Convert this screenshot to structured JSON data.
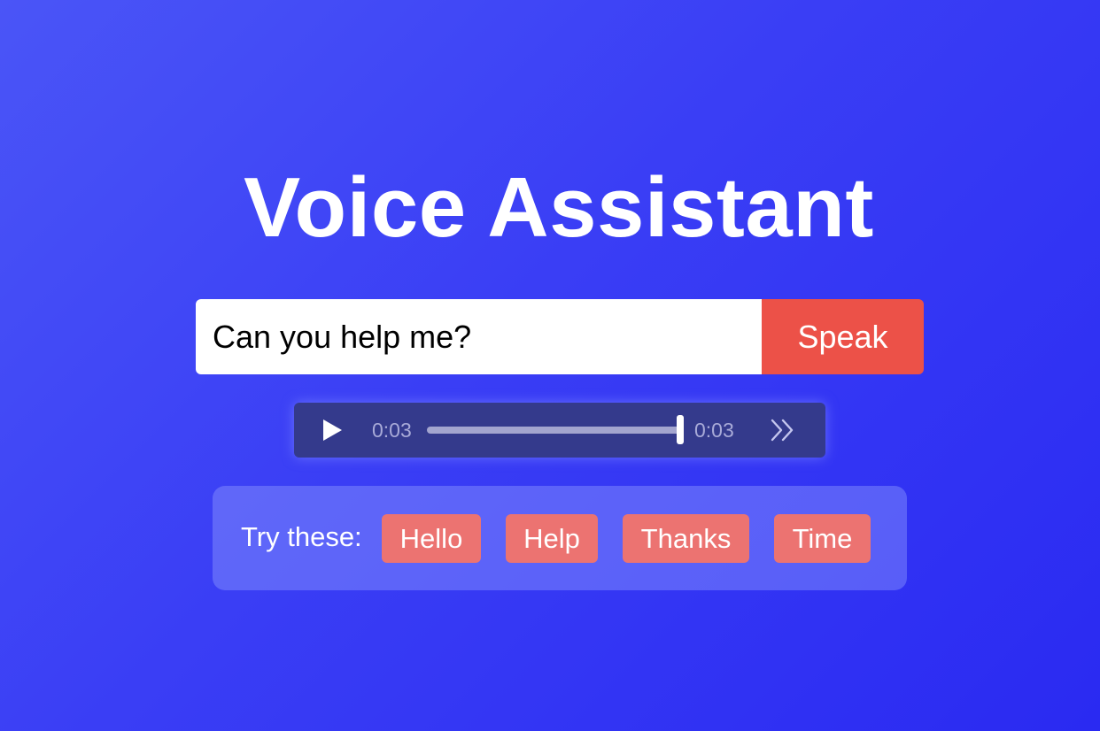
{
  "app": {
    "title": "Voice Assistant"
  },
  "input": {
    "value": "Can you help me?",
    "speak_label": "Speak"
  },
  "player": {
    "current_time": "0:03",
    "total_time": "0:03",
    "progress": 1.0,
    "play_icon": "play-icon",
    "forward_icon": "fast-forward-icon"
  },
  "suggestions": {
    "label": "Try these:",
    "chips": [
      "Hello",
      "Help",
      "Thanks",
      "Time"
    ]
  },
  "colors": {
    "background_start": "#4a55f7",
    "background_end": "#2a2af2",
    "speak_button": "#ec5148",
    "chip": "#ec7371",
    "player_background": "#343a8c"
  }
}
